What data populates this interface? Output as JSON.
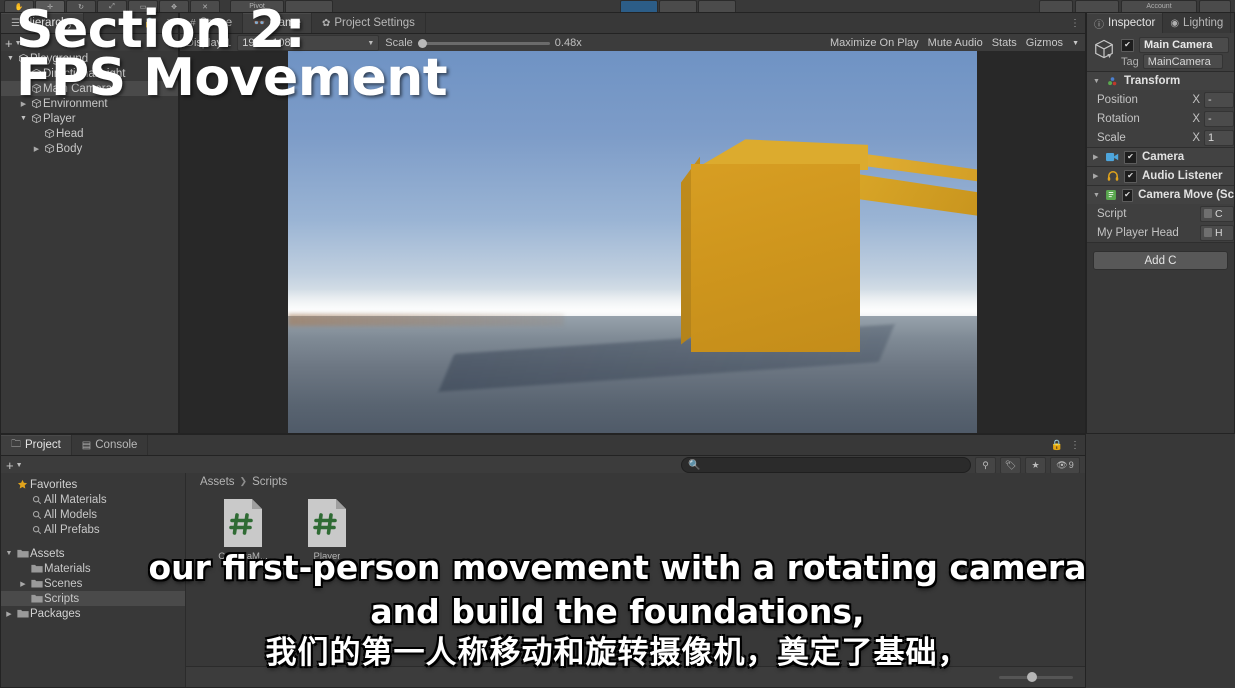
{
  "toolbar": {
    "tool_buttons": [
      "hand-tool",
      "move-tool",
      "rotate-tool",
      "scale-tool",
      "rect-tool",
      "transform-tool",
      "custom-tool"
    ],
    "pivot_label": "Pivot",
    "play_buttons": [
      "play",
      "pause",
      "step"
    ],
    "play_active": true,
    "right_buttons": [
      "layers",
      "account",
      "layout"
    ],
    "account_label": "Account"
  },
  "hierarchy": {
    "tab_label": "Hierarchy",
    "tab_icon": "hierarchy-icon",
    "lock_icon": "lock-icon",
    "menu_icon": "kebab-menu-icon",
    "add_label": "+",
    "items": [
      {
        "label": "Playground",
        "depth": 0,
        "expanded": true,
        "selected": false
      },
      {
        "label": "Directional Light",
        "depth": 1,
        "expanded": null,
        "selected": false
      },
      {
        "label": "Main Camera",
        "depth": 1,
        "expanded": null,
        "selected": true
      },
      {
        "label": "Environment",
        "depth": 1,
        "expanded": false,
        "selected": false
      },
      {
        "label": "Player",
        "depth": 1,
        "expanded": true,
        "selected": false
      },
      {
        "label": "Head",
        "depth": 2,
        "expanded": null,
        "selected": false
      },
      {
        "label": "Body",
        "depth": 2,
        "expanded": false,
        "selected": false
      }
    ]
  },
  "gameview": {
    "tabs": [
      {
        "label": "Scene",
        "icon": "grid-icon",
        "active": false
      },
      {
        "label": "Game",
        "icon": "gamepad-icon",
        "active": true
      },
      {
        "label": "Project Settings",
        "icon": "gear-icon",
        "active": false
      }
    ],
    "menu_icon": "kebab-menu-icon",
    "display_label": "Display 1",
    "resolution": "1920x1080",
    "scale_label": "Scale",
    "scale_value": "0.48x",
    "maximize_label": "Maximize On Play",
    "mute_label": "Mute Audio",
    "stats_label": "Stats",
    "gizmos_label": "Gizmos"
  },
  "inspector": {
    "tabs": [
      {
        "label": "Inspector",
        "icon": "info-icon",
        "active": true
      },
      {
        "label": "Lighting",
        "icon": "light-bulb-icon",
        "active": false
      }
    ],
    "object_icon": "prefab-cube-icon",
    "object_name": "Main Camera",
    "object_enabled": true,
    "tag_label": "Tag",
    "tag_value": "MainCamera",
    "components": [
      {
        "name": "Transform",
        "icon": "transform-icon",
        "expanded": true,
        "has_checkbox": false,
        "properties": [
          {
            "label": "Position",
            "axis": "X",
            "value": "-"
          },
          {
            "label": "Rotation",
            "axis": "X",
            "value": "-"
          },
          {
            "label": "Scale",
            "axis": "X",
            "value": "1"
          }
        ]
      },
      {
        "name": "Camera",
        "icon": "camera-icon",
        "expanded": false,
        "has_checkbox": true,
        "enabled": true,
        "properties": []
      },
      {
        "name": "Audio Listener",
        "icon": "headphones-icon",
        "expanded": false,
        "has_checkbox": true,
        "enabled": true,
        "properties": []
      },
      {
        "name": "Camera Move (Sc",
        "icon": "script-icon",
        "expanded": true,
        "has_checkbox": true,
        "enabled": true,
        "properties": [
          {
            "label": "Script",
            "axis": "",
            "value": "C",
            "kind": "object"
          },
          {
            "label": "My Player Head",
            "axis": "",
            "value": "H",
            "kind": "object"
          }
        ]
      }
    ],
    "add_component_label": "Add C"
  },
  "project": {
    "tabs": [
      {
        "label": "Project",
        "icon": "folder-icon",
        "active": true
      },
      {
        "label": "Console",
        "icon": "console-icon",
        "active": false
      }
    ],
    "lock_icon": "lock-icon",
    "menu_icon": "kebab-menu-icon",
    "add_label": "+",
    "search_placeholder": "",
    "search_icon": "search-icon",
    "filter_buttons": [
      {
        "icon": "search-by-type-icon",
        "label": ""
      },
      {
        "icon": "label-tag-icon",
        "label": ""
      },
      {
        "icon": "favorite-star-icon",
        "label": ""
      },
      {
        "icon": "hidden-packages-icon",
        "label": "9"
      }
    ],
    "tree": [
      {
        "label": "Favorites",
        "depth": 0,
        "icon": "star-icon",
        "arrow": "none",
        "selected": false
      },
      {
        "label": "All Materials",
        "depth": 1,
        "icon": "search-icon",
        "arrow": "none",
        "selected": false
      },
      {
        "label": "All Models",
        "depth": 1,
        "icon": "search-icon",
        "arrow": "none",
        "selected": false
      },
      {
        "label": "All Prefabs",
        "depth": 1,
        "icon": "search-icon",
        "arrow": "none",
        "selected": false
      },
      {
        "label": "",
        "depth": 0,
        "icon": "spacer",
        "arrow": "none",
        "selected": false
      },
      {
        "label": "Assets",
        "depth": 0,
        "icon": "folder-open-icon",
        "arrow": "down",
        "selected": false
      },
      {
        "label": "Materials",
        "depth": 1,
        "icon": "folder-icon",
        "arrow": "none",
        "selected": false
      },
      {
        "label": "Scenes",
        "depth": 1,
        "icon": "folder-icon",
        "arrow": "right",
        "selected": false
      },
      {
        "label": "Scripts",
        "depth": 1,
        "icon": "folder-icon",
        "arrow": "none",
        "selected": true
      },
      {
        "label": "Packages",
        "depth": 0,
        "icon": "folder-icon",
        "arrow": "right",
        "selected": false
      }
    ],
    "breadcrumb": [
      "Assets",
      "Scripts"
    ],
    "assets": [
      {
        "label": "CameraM...",
        "icon": "csharp-script-icon"
      },
      {
        "label": "Player",
        "icon": "csharp-script-icon"
      }
    ],
    "zoom_slider": 38
  },
  "overlay": {
    "title": "Section 2:\nFPS Movement",
    "subtitle_lines": [
      {
        "text": "our first-person movement with a rotating camera",
        "cjk": false
      },
      {
        "text": "and build the foundations,",
        "cjk": false
      },
      {
        "text": "我们的第一人称移动和旋转摄像机，奠定了基础，",
        "cjk": true
      }
    ]
  },
  "colors": {
    "panel_bg": "#383838",
    "panel_header": "#3f3f3f",
    "selection": "#4a4a4a",
    "accent_play": "#2c5d87",
    "cube_gold": "#cf961d",
    "csharp_green": "#2f6b34"
  }
}
